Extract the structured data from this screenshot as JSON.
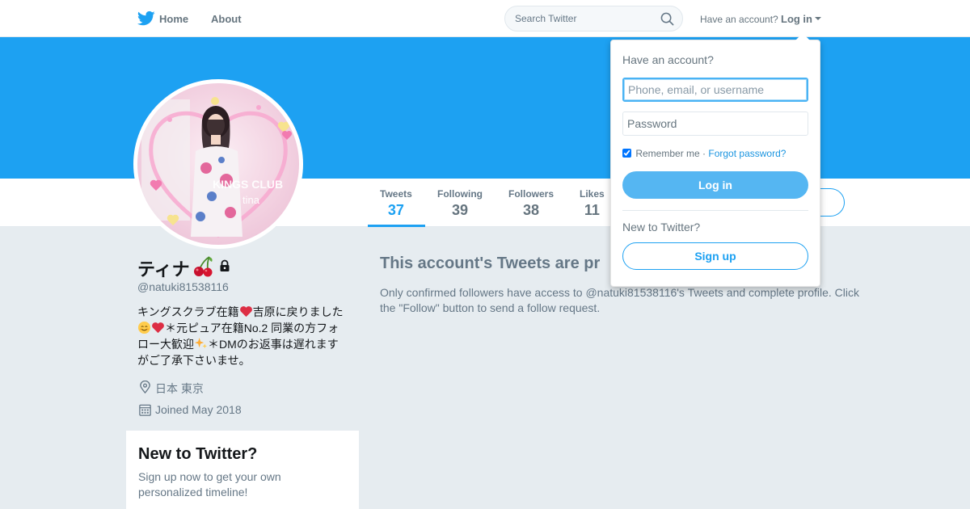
{
  "nav": {
    "home_label": "Home",
    "about_label": "About",
    "search_placeholder": "Search Twitter",
    "have_account_text": "Have an account?",
    "login_label": "Log in"
  },
  "profile": {
    "display_name": "ティナ",
    "handle": "@natuki81538116",
    "avatar_caption_line1": "KINGS CLUB",
    "avatar_caption_line2": "tina",
    "bio": {
      "part1": "キングスクラブ在籍",
      "part2": "吉原に戻りました",
      "part3": "＊元ピュア在籍No.2 同業の方フォロー大歓迎",
      "part4": "＊DMのお返事は遅れますがご了承下さいませ。"
    },
    "location": "日本 東京",
    "joined": "Joined May 2018"
  },
  "stats": [
    {
      "label": "Tweets",
      "value": "37"
    },
    {
      "label": "Following",
      "value": "39"
    },
    {
      "label": "Followers",
      "value": "38"
    },
    {
      "label": "Likes",
      "value": "11"
    }
  ],
  "protected": {
    "title": "This account's Tweets are pr",
    "text": "Only confirmed followers have access to @natuki81538116's Tweets and complete profile. Click the \"Follow\" button to send a follow request."
  },
  "signup_card": {
    "title": "New to Twitter?",
    "text": "Sign up now to get your own personalized timeline!"
  },
  "login_dropdown": {
    "title": "Have an account?",
    "username_placeholder": "Phone, email, or username",
    "password_placeholder": "Password",
    "remember_label": "Remember me ·",
    "forgot_label": "Forgot password?",
    "login_button": "Log in",
    "new_label": "New to Twitter?",
    "signup_button": "Sign up"
  },
  "colors": {
    "brand": "#1da1f2",
    "page_background": "#e6ecf0",
    "muted_text": "#657786"
  }
}
